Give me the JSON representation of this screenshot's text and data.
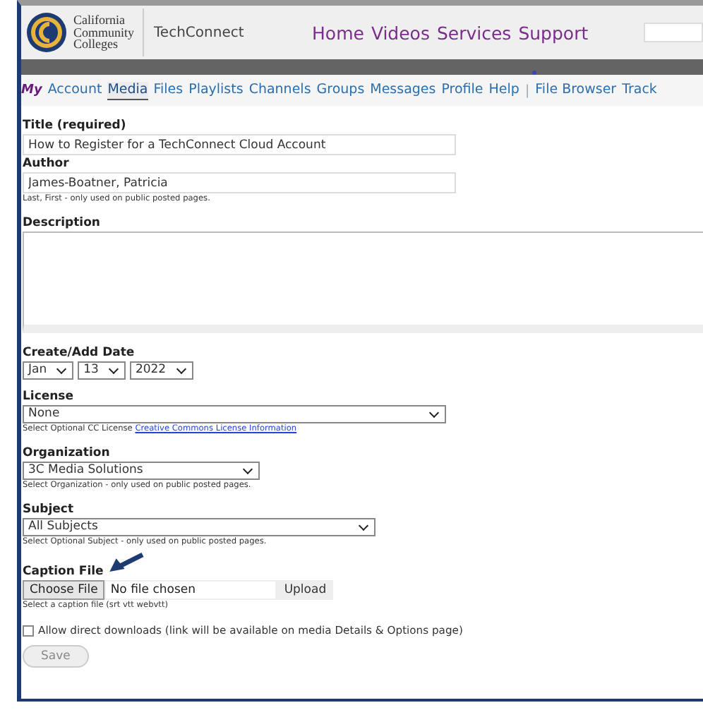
{
  "header": {
    "logo_lines": [
      "California",
      "Community",
      "Colleges"
    ],
    "site_name": "TechConnect",
    "nav": [
      "Home",
      "Videos",
      "Services",
      "Support"
    ]
  },
  "tabs": {
    "prefix": "My",
    "separator": "|",
    "groups": [
      [
        {
          "label": "Account",
          "selected": false
        },
        {
          "label": "Media",
          "selected": true
        },
        {
          "label": "Files",
          "selected": false
        },
        {
          "label": "Playlists",
          "selected": false
        },
        {
          "label": "Channels",
          "selected": false
        },
        {
          "label": "Groups",
          "selected": false
        },
        {
          "label": "Messages",
          "selected": false
        },
        {
          "label": "Profile",
          "selected": false
        },
        {
          "label": "Help",
          "selected": false
        }
      ],
      [
        {
          "label": "File Browser",
          "selected": false
        },
        {
          "label": "Track",
          "selected": false
        }
      ]
    ]
  },
  "form": {
    "title": {
      "label": "Title (required)",
      "value": "How to Register for a TechConnect Cloud Account"
    },
    "author": {
      "label": "Author",
      "value": "James-Boatner, Patricia",
      "hint": "Last, First - only used on public posted pages."
    },
    "description": {
      "label": "Description"
    },
    "date": {
      "label": "Create/Add Date",
      "month": "Jan",
      "day": "13",
      "year": "2022"
    },
    "license": {
      "label": "License",
      "value": "None",
      "hint": "Select Optional CC License",
      "link": "Creative Commons License Information"
    },
    "organization": {
      "label": "Organization",
      "value": "3C Media Solutions",
      "hint": "Select Organization - only used on public posted pages."
    },
    "subject": {
      "label": "Subject",
      "value": "All Subjects",
      "hint": "Select Optional Subject - only used on public posted pages."
    },
    "caption": {
      "label": "Caption File",
      "choose_button": "Choose File",
      "file_status": "No file chosen",
      "upload_button": "Upload",
      "hint": "Select a caption file (srt vtt webvtt)"
    },
    "downloads": {
      "label": "Allow direct downloads (link will be available on media Details & Options page)",
      "checked": false
    },
    "save_button": "Save"
  }
}
